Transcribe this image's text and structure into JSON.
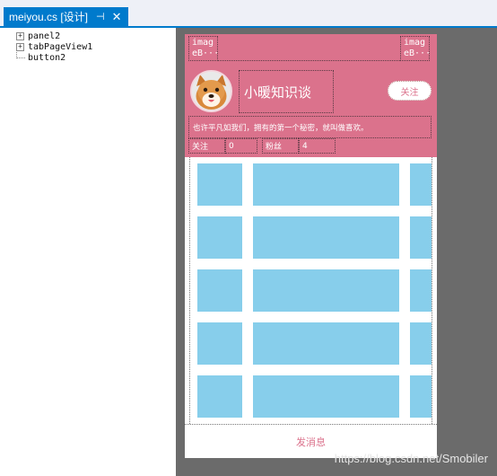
{
  "tab": {
    "title": "meiyou.cs [设计]",
    "pin_glyph": "⊣",
    "close_glyph": "✕"
  },
  "outline": {
    "items": [
      {
        "label": "panel2",
        "expandable": true
      },
      {
        "label": "tabPageView1",
        "expandable": true
      },
      {
        "label": "button2",
        "expandable": false
      }
    ]
  },
  "form": {
    "header": {
      "background": "#db728c",
      "left_image_button": "imag\neB···",
      "right_image_button": "imag\neB···",
      "title": "小暖知识谈",
      "follow_button": "关注",
      "motto": "也许平凡如我们，拥有的第一个秘密，就叫做喜欢。",
      "stats": {
        "following_label": "关注",
        "following_value": "0",
        "fans_label": "粉丝",
        "fans_value": "4"
      }
    },
    "grid_cell_color": "#87ceeb",
    "footer_button": "发消息"
  },
  "watermark": "https://blog.csdn.net/Smobiler"
}
